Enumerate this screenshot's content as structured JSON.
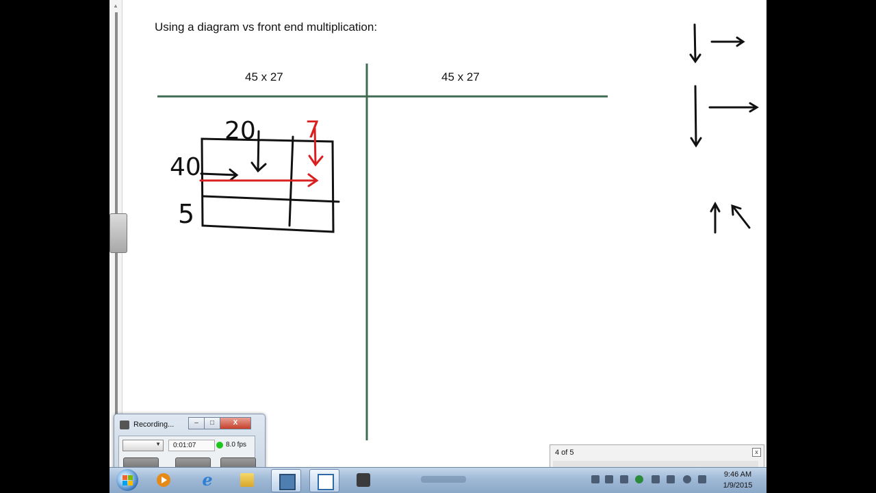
{
  "slide": {
    "title": "Using a diagram vs front end multiplication:",
    "problem_left": "45 x 27",
    "problem_right": "45 x 27"
  },
  "handwriting": {
    "top_labels": [
      "20",
      "7"
    ],
    "side_labels": [
      "40",
      "5"
    ]
  },
  "recorder": {
    "title": "Recording...",
    "timer": "0:01:07",
    "fps": "8.0 fps",
    "close_label": "X"
  },
  "page_indicator": {
    "text": "4 of 5",
    "close_label": "x"
  },
  "taskbar": {
    "apps": [
      "windows-media-player",
      "internet-explorer",
      "windows-explorer",
      "screen-app",
      "notes-app",
      "recorder-app"
    ]
  },
  "clock": {
    "time": "9:46 AM",
    "date": "1/9/2015"
  },
  "colors": {
    "ink_black": "#111111",
    "ink_red": "#d92020",
    "divider_green": "#3e6b52"
  }
}
